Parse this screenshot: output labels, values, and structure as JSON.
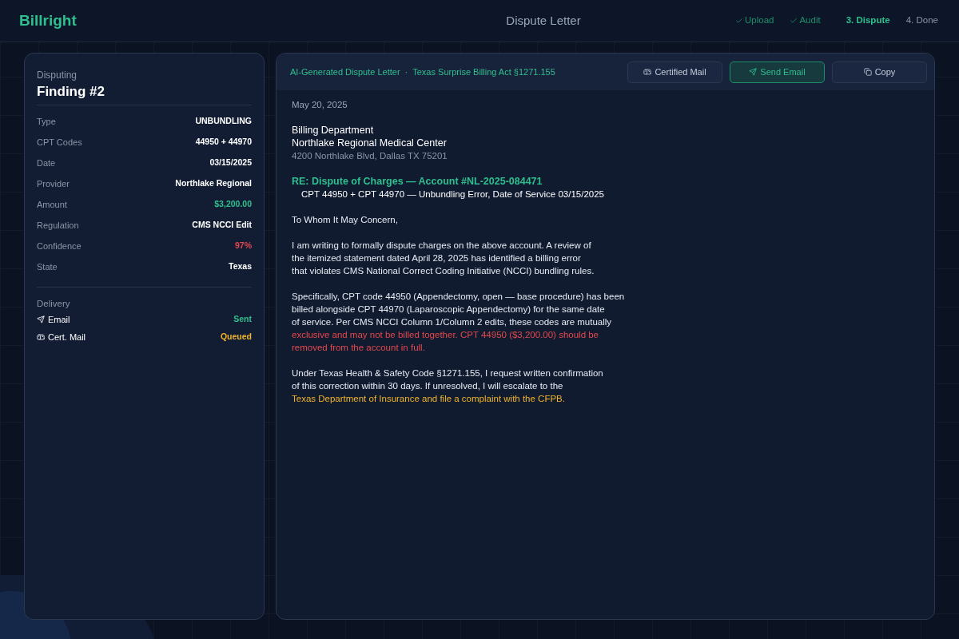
{
  "app": {
    "logo": "Billright",
    "title": "Dispute Letter"
  },
  "steps": [
    {
      "label": "Upload",
      "done": true,
      "selected": false
    },
    {
      "label": "Audit",
      "done": true,
      "selected": false
    },
    {
      "label": "3. Dispute",
      "done": false,
      "selected": true
    },
    {
      "label": "4. Done",
      "done": false,
      "selected": false
    }
  ],
  "finding": {
    "eyebrow": "Disputing",
    "title": "Finding #2",
    "fields": [
      {
        "label": "Type",
        "value": "UNBUNDLING",
        "color": "#ffffff"
      },
      {
        "label": "CPT Codes",
        "value": "44950 + 44970",
        "color": "#ffffff"
      },
      {
        "label": "Date",
        "value": "03/15/2025",
        "color": "#ffffff"
      },
      {
        "label": "Provider",
        "value": "Northlake Regional",
        "color": "#ffffff"
      },
      {
        "label": "Amount",
        "value": "$3,200.00",
        "color": "#2fbf8f"
      },
      {
        "label": "Regulation",
        "value": "CMS NCCI Edit",
        "color": "#ffffff"
      },
      {
        "label": "Confidence",
        "value": "97%",
        "color": "#e5484d"
      },
      {
        "label": "State",
        "value": "Texas",
        "color": "#ffffff"
      }
    ],
    "delivery_heading": "Delivery",
    "delivery": [
      {
        "kind": "email",
        "label": "Email",
        "status": "Sent",
        "color": "#2fbf8f"
      },
      {
        "kind": "mail",
        "label": "Cert. Mail",
        "status": "Queued",
        "color": "#f0b429"
      }
    ]
  },
  "letter": {
    "header": "AI-Generated Dispute Letter",
    "separator": "·",
    "regulation": "Texas Surprise Billing Act §1271.155",
    "buttons": [
      {
        "kind": "mail",
        "label": "Certified Mail",
        "selected": false
      },
      {
        "kind": "email",
        "label": "Send Email",
        "selected": true
      },
      {
        "kind": "copy",
        "label": "Copy",
        "selected": false
      }
    ],
    "date": "May 20, 2025",
    "recipient": [
      "Billing Department",
      "Northlake Regional Medical Center"
    ],
    "address": "4200 Northlake Blvd, Dallas TX 75201",
    "subject": "RE: Dispute of Charges — Account #NL-2025-084471",
    "subject_detail": "CPT 44950 + CPT 44970 — Unbundling Error, Date of Service 03/15/2025",
    "salutation": "To Whom It May Concern,",
    "paragraphs": [
      {
        "lines": [
          {
            "text": "I am writing to formally dispute charges on the above account. A review of",
            "color": "#e6ebf2"
          },
          {
            "text": "the itemized statement dated April 28, 2025 has identified a billing error",
            "color": "#e6ebf2"
          },
          {
            "text": "that violates CMS National Correct Coding Initiative (NCCI) bundling rules.",
            "color": "#e6ebf2"
          }
        ]
      },
      {
        "lines": [
          {
            "text": "Specifically, CPT code 44950 (Appendectomy, open — base procedure) has been",
            "color": "#e6ebf2"
          },
          {
            "text": "billed alongside CPT 44970 (Laparoscopic Appendectomy) for the same date",
            "color": "#e6ebf2"
          },
          {
            "text": "of service. Per CMS NCCI Column 1/Column 2 edits, these codes are mutually",
            "color": "#e6ebf2"
          },
          {
            "text": "exclusive and may not be billed together. CPT 44950 ($3,200.00) should be",
            "color": "#e5484d"
          },
          {
            "text": "removed from the account in full.",
            "color": "#e5484d"
          }
        ]
      },
      {
        "lines": [
          {
            "text": "Under Texas Health & Safety Code §1271.155, I request written confirmation",
            "color": "#e6ebf2"
          },
          {
            "text": "of this correction within 30 days. If unresolved, I will escalate to the",
            "color": "#e6ebf2"
          },
          {
            "text": "Texas Department of Insurance and file a complaint with the CFPB.",
            "color": "#f0b429"
          }
        ]
      }
    ]
  }
}
